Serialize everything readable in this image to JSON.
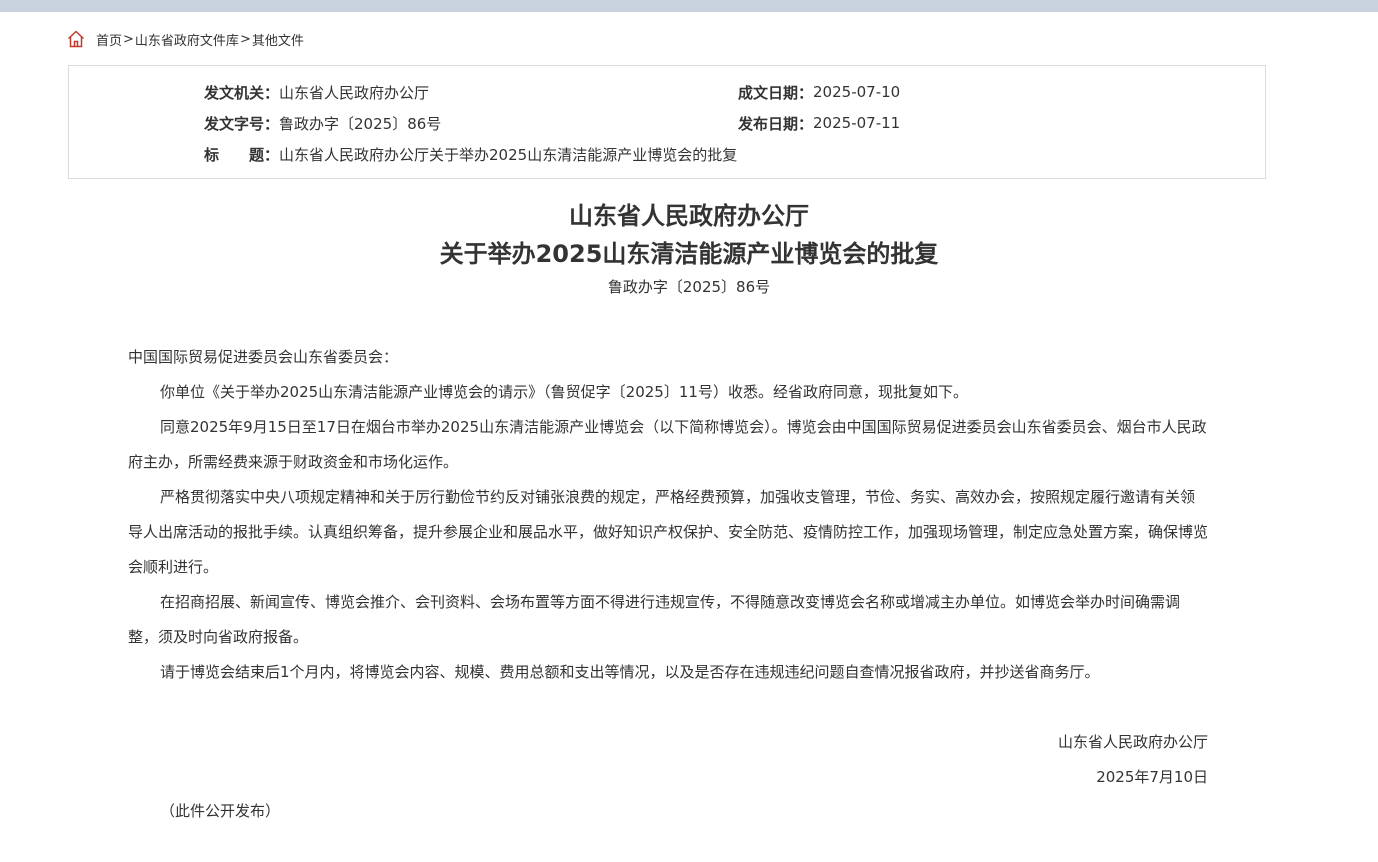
{
  "breadcrumb": {
    "home": "首页",
    "library": "山东省政府文件库",
    "current": "其他文件",
    "separator": ">",
    "icon": "home-icon",
    "icon_color": "#c0392b"
  },
  "meta": {
    "issuer_label": "发文机关：",
    "issuer": "山东省人民政府办公厅",
    "date_written_label": "成文日期：",
    "date_written": "2025-07-10",
    "doc_no_label": "发文字号：",
    "doc_no": "鲁政办字〔2025〕86号",
    "date_published_label": "发布日期：",
    "date_published": "2025-07-11",
    "title_label": "标　　题：",
    "title": "山东省人民政府办公厅关于举办2025山东清洁能源产业博览会的批复"
  },
  "document": {
    "title_line1": "山东省人民政府办公厅",
    "title_line2": "关于举办2025山东清洁能源产业博览会的批复",
    "doc_no": "鲁政办字〔2025〕86号",
    "salutation": "中国国际贸易促进委员会山东省委员会：",
    "paragraphs": [
      "你单位《关于举办2025山东清洁能源产业博览会的请示》（鲁贸促字〔2025〕11号）收悉。经省政府同意，现批复如下。",
      "同意2025年9月15日至17日在烟台市举办2025山东清洁能源产业博览会（以下简称博览会）。博览会由中国国际贸易促进委员会山东省委员会、烟台市人民政府主办，所需经费来源于财政资金和市场化运作。",
      "严格贯彻落实中央八项规定精神和关于厉行勤俭节约反对铺张浪费的规定，严格经费预算，加强收支管理，节俭、务实、高效办会，按照规定履行邀请有关领导人出席活动的报批手续。认真组织筹备，提升参展企业和展品水平，做好知识产权保护、安全防范、疫情防控工作，加强现场管理，制定应急处置方案，确保博览会顺利进行。",
      "在招商招展、新闻宣传、博览会推介、会刊资料、会场布置等方面不得进行违规宣传，不得随意改变博览会名称或增减主办单位。如博览会举办时间确需调整，须及时向省政府报备。",
      "请于博览会结束后1个月内，将博览会内容、规模、费用总额和支出等情况，以及是否存在违规违纪问题自查情况报省政府，并抄送省商务厅。"
    ],
    "signature": "山东省人民政府办公厅",
    "signature_date": "2025年7月10日",
    "note": "（此件公开发布）"
  }
}
